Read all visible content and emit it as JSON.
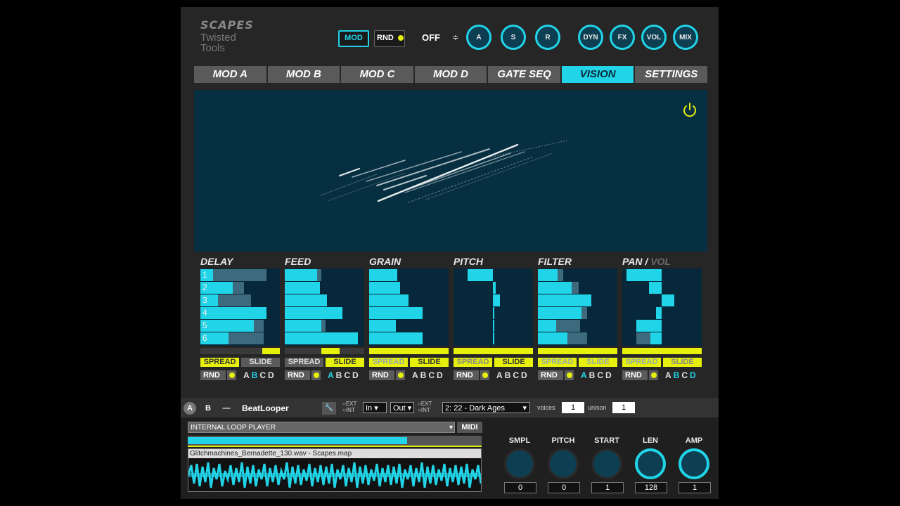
{
  "header": {
    "logo_line1": "SCAPES",
    "logo_line2": "Twisted",
    "logo_line3": "Tools",
    "mod_label": "MOD",
    "rnd_label": "RND",
    "off_label": "OFF",
    "stepper_glyph": "≑",
    "knobs": [
      "A",
      "S",
      "R",
      "DYN",
      "FX",
      "VOL",
      "MIX"
    ]
  },
  "tabs": [
    "MOD A",
    "MOD B",
    "MOD C",
    "MOD D",
    "GATE SEQ",
    "VISION",
    "SETTINGS"
  ],
  "active_tab": "VISION",
  "columns": [
    {
      "title": "DELAY",
      "title_suffix": "",
      "rows": [
        "1",
        "2",
        "3",
        "4",
        "5",
        "6"
      ],
      "spread": "SPREAD",
      "slide": "SLIDE",
      "rnd": "RND",
      "letters": [
        "A",
        "B",
        "C",
        "D"
      ],
      "active_letter": "B"
    },
    {
      "title": "FEED",
      "title_suffix": "",
      "rows": [],
      "spread": "SPREAD",
      "slide": "SLIDE",
      "rnd": "RND",
      "letters": [
        "A",
        "B",
        "C",
        "D"
      ],
      "active_letter": "A"
    },
    {
      "title": "GRAIN",
      "title_suffix": "",
      "rows": [],
      "spread": "SPREAD",
      "slide": "SLIDE",
      "rnd": "RND",
      "letters": [
        "A",
        "B",
        "C",
        "D"
      ],
      "active_letter": ""
    },
    {
      "title": "PITCH",
      "title_suffix": "",
      "rows": [],
      "spread": "SPREAD",
      "slide": "SLIDE",
      "rnd": "RND",
      "letters": [
        "A",
        "B",
        "C",
        "D"
      ],
      "active_letter": ""
    },
    {
      "title": "FILTER",
      "title_suffix": "",
      "rows": [],
      "spread": "SPREAD",
      "slide": "SLIDE",
      "rnd": "RND",
      "letters": [
        "A",
        "B",
        "C",
        "D"
      ],
      "active_letter": "A"
    },
    {
      "title": "PAN / ",
      "title_suffix": "VOL",
      "rows": [],
      "spread": "SPREAD",
      "slide": "SLIDE",
      "rnd": "RND",
      "letters": [
        "A",
        "B",
        "C",
        "D"
      ],
      "active_letter": "B"
    }
  ],
  "bottom": {
    "a_label": "A",
    "b_label": "B",
    "dash_label": "—",
    "instrument_name": "BeatLooper",
    "wrench_glyph": "🔧",
    "ext_label": "EXT",
    "int_label": "INT",
    "in_label": "In",
    "out_label": "Out",
    "preset": "2: 22 - Dark Ages",
    "voices_label": "voices",
    "voices_value": "1",
    "unison_label": "unison",
    "unison_value": "1",
    "player": "INTERNAL LOOP PLAYER",
    "midi_label": "MIDI",
    "sample_file": "Glitchmachines_Bernadette_130.wav - Scapes.map",
    "knobs": [
      {
        "label": "SMPL",
        "value": "0"
      },
      {
        "label": "PITCH",
        "value": "0"
      },
      {
        "label": "START",
        "value": "1"
      },
      {
        "label": "LEN",
        "value": "128"
      },
      {
        "label": "AMP",
        "value": "1"
      }
    ]
  }
}
